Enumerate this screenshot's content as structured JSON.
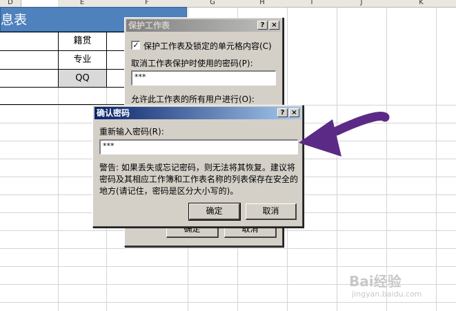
{
  "spreadsheet": {
    "column_headers": [
      "D",
      "E",
      "F",
      "G",
      "H",
      "I",
      "J",
      "K"
    ],
    "title_partial": "息表",
    "table_labels": [
      "籍贯",
      "专业",
      "QQ"
    ]
  },
  "protect_dialog": {
    "title": "保护工作表",
    "help_button": "?",
    "close_button": "×",
    "checkbox_label": "保护工作表及锁定的单元格内容(C)",
    "checkbox_checked": "✓",
    "password_label": "取消工作表保护时使用的密码(P):",
    "password_value": "***",
    "allow_label": "允许此工作表的所有用户进行(O):",
    "ok_label": "确定",
    "cancel_label": "取消"
  },
  "confirm_dialog": {
    "title": "确认密码",
    "help_button": "?",
    "close_button": "×",
    "reenter_label": "重新输入密码(R):",
    "password_value": "***",
    "warning_lines": [
      "警告: 如果丢失或忘记密码，则无法将其恢复。建议将",
      "密码及其相应工作簿和工作表名称的列表保存在安全的",
      "地方(请记住，密码是区分大小写的)。"
    ],
    "ok_label": "确定",
    "cancel_label": "取消"
  },
  "watermark": {
    "brand": "Bai经验",
    "url": "jingyan.baidu.com"
  },
  "colors": {
    "title_band": "#4f81bd",
    "arrow": "#5b2a86",
    "dialog_bg": "#d4d0c8"
  }
}
